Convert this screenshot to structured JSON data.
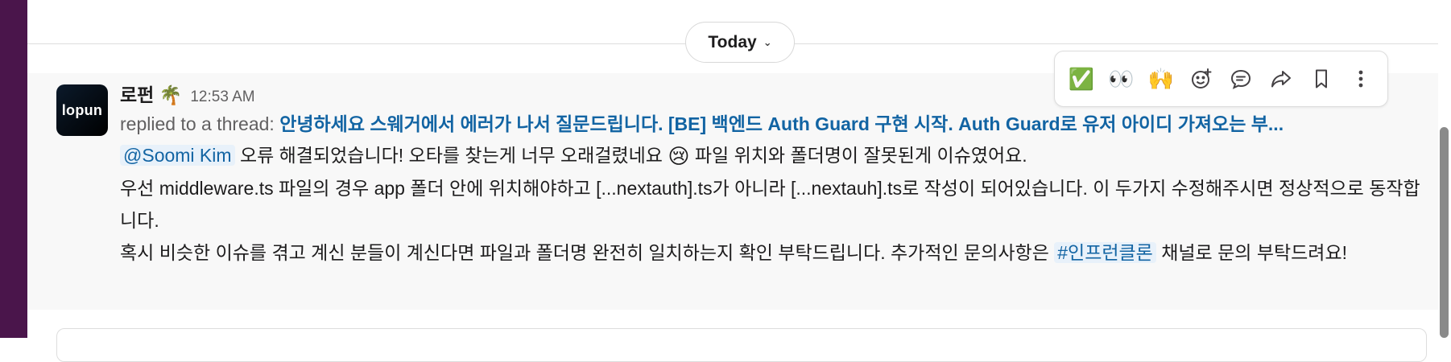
{
  "date_divider": {
    "label": "Today"
  },
  "message": {
    "avatar_text": "lopun",
    "author": "로펀",
    "author_emoji": "🌴",
    "time": "12:53 AM",
    "thread_prefix": "replied to a thread:",
    "thread_title": "안녕하세요 스웨거에서 에러가 나서 질문드립니다. [BE] 백엔드 Auth Guard 구현 시작. Auth Guard로 유저 아이디 가져오는 부...",
    "line1_mention": "@Soomi Kim",
    "line1_text": "오류 해결되었습니다! 오타를 찾는게 너무 오래걸렸네요",
    "line1_emoji": "😢",
    "line1_tail": "파일 위치와 폴더명이 잘못된게 이슈였어요.",
    "line2": "우선 middleware.ts 파일의 경우 app 폴더 안에 위치해야하고 [...nextauth].ts가 아니라 [...nextauh].ts로 작성이 되어있습니다. 이 두가지 수정해주시면 정상적으로 동작합니다.",
    "line3_pre": "혹시 비슷한 이슈를 겪고 계신 분들이 계신다면 파일과 폴더명 완전히 일치하는지 확인 부탁드립니다. 추가적인 문의사항은",
    "line3_channel": "#인프런클론",
    "line3_post": "채널로 문의 부탁드려요!"
  },
  "actions": {
    "check_emoji": "✅",
    "eyes_emoji": "👀",
    "raised_hands_emoji": "🙌"
  }
}
